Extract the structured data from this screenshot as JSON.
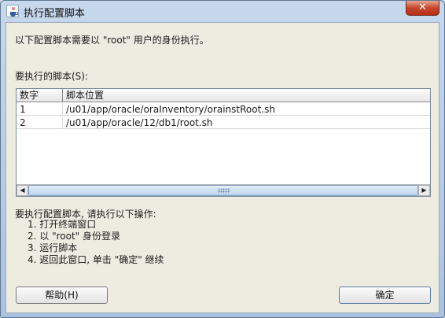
{
  "window": {
    "title": "执行配置脚本",
    "close_glyph": "✕"
  },
  "description": "以下配置脚本需要以 \"root\" 用户的身份执行。",
  "scripts_label": "要执行的脚本(S):",
  "table": {
    "columns": [
      "数字",
      "脚本位置"
    ],
    "rows": [
      {
        "num": "1",
        "path": "/u01/app/oracle/oraInventory/orainstRoot.sh"
      },
      {
        "num": "2",
        "path": "/u01/app/oracle/12/db1/root.sh"
      }
    ]
  },
  "scrollbar": {
    "left_arrow": "◀",
    "right_arrow": "▶"
  },
  "instructions": {
    "title": "要执行配置脚本, 请执行以下操作:",
    "steps": [
      "1. 打开终端窗口",
      "2. 以 \"root\" 身份登录",
      "3. 运行脚本",
      "4. 返回此窗口, 单击 \"确定\" 继续"
    ]
  },
  "buttons": {
    "help": "帮助(H)",
    "ok": "确定"
  },
  "icons": {
    "window_icon": "java-cup-icon"
  }
}
